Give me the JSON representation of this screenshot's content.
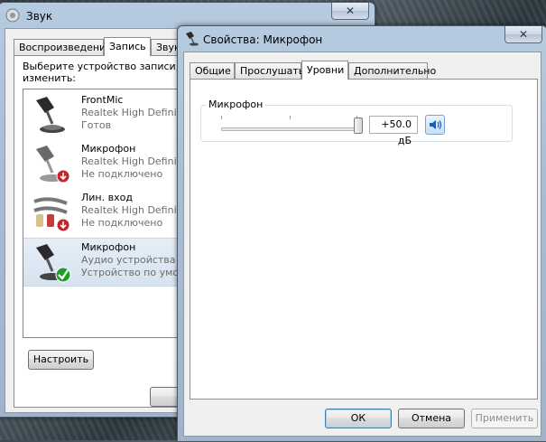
{
  "background_window": {
    "title": "Звук",
    "tabs": [
      {
        "label": "Воспроизведение",
        "active": false
      },
      {
        "label": "Запись",
        "active": true
      },
      {
        "label": "Звук",
        "active": false
      }
    ],
    "instruction_line1": "Выберите устройство записи, п",
    "instruction_line2": "изменить:",
    "devices": [
      {
        "name": "FrontMic",
        "line1": "Realtek High Definit",
        "line2": "Готов",
        "icon": "microphone-icon",
        "status": "ready"
      },
      {
        "name": "Микрофон",
        "line1": "Realtek High Definit",
        "line2": "Не подключено",
        "icon": "microphone-icon",
        "status": "not-connected"
      },
      {
        "name": "Лин. вход",
        "line1": "Realtek High Definit",
        "line2": "Не подключено",
        "icon": "line-in-cable-icon",
        "status": "not-connected"
      },
      {
        "name": "Микрофон",
        "line1": "Аудио устройства U",
        "line2": "Устройство по умо",
        "icon": "microphone-icon",
        "status": "default",
        "selected": true
      }
    ],
    "configure_button": "Настроить",
    "close_glyph": "✕"
  },
  "properties_dialog": {
    "title": "Свойства: Микрофон",
    "close_glyph": "✕",
    "tabs": [
      {
        "label": "Общие",
        "active": false
      },
      {
        "label": "Прослушать",
        "active": false
      },
      {
        "label": "Уровни",
        "active": true
      },
      {
        "label": "Дополнительно",
        "active": false
      }
    ],
    "levels": {
      "group_label": "Микрофон",
      "level_value": "+50.0 дБ",
      "slider_position_fraction": 1.0,
      "speaker_icon": "speaker-volume-icon"
    },
    "buttons": {
      "ok": "ОК",
      "cancel": "Отмена",
      "apply": "Применить"
    }
  },
  "colors": {
    "selection": "#d6e3f0",
    "status_red": "#c0262c",
    "status_green": "#1f9e2a",
    "frame_blue": "#a7bdd4"
  }
}
